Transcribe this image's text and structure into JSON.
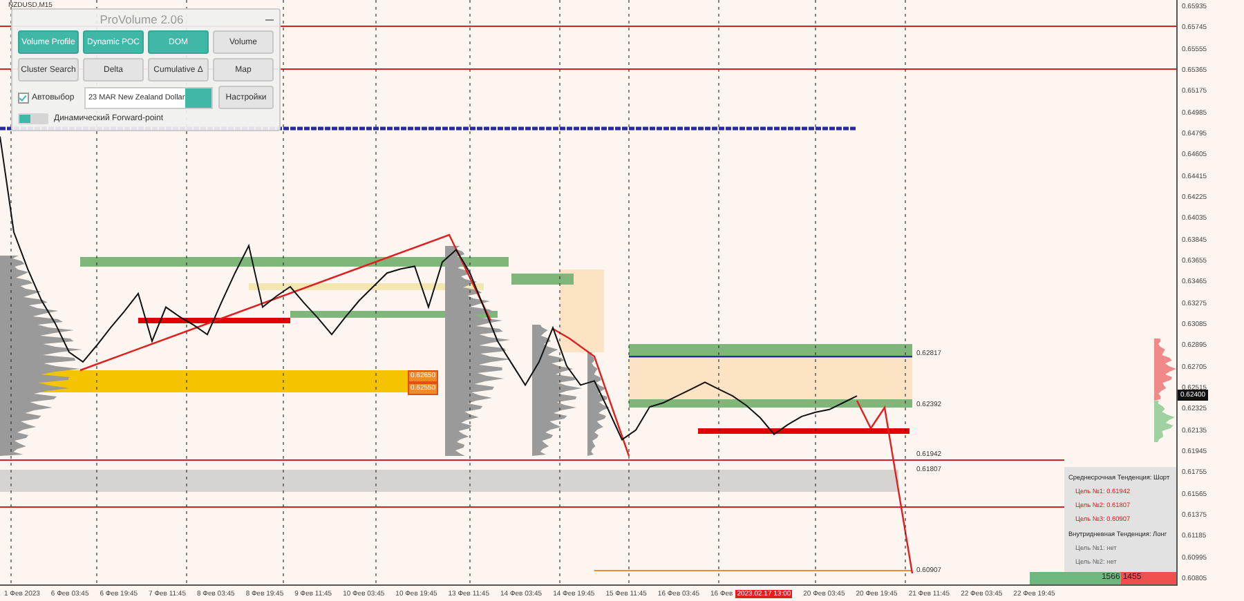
{
  "chart": {
    "chart_data": {
      "type": "line",
      "grid": true,
      "ylim": [
        0.60756,
        0.65996
      ],
      "yticks": [
        {
          "value": 0.65935,
          "label": "0.65935"
        },
        {
          "value": 0.65745,
          "label": "0.65745"
        },
        {
          "value": 0.65555,
          "label": "0.65555"
        },
        {
          "value": 0.65365,
          "label": "0.65365"
        },
        {
          "value": 0.65175,
          "label": "0.65175"
        },
        {
          "value": 0.64985,
          "label": "0.64985"
        },
        {
          "value": 0.64795,
          "label": "0.64795"
        },
        {
          "value": 0.64605,
          "label": "0.64605"
        },
        {
          "value": 0.64415,
          "label": "0.64415"
        },
        {
          "value": 0.64225,
          "label": "0.64225"
        },
        {
          "value": 0.64035,
          "label": "0.64035"
        },
        {
          "value": 0.63845,
          "label": "0.63845"
        },
        {
          "value": 0.63655,
          "label": "0.63655"
        },
        {
          "value": 0.63465,
          "label": "0.63465"
        },
        {
          "value": 0.63275,
          "label": "0.63275"
        },
        {
          "value": 0.63085,
          "label": "0.63085"
        },
        {
          "value": 0.62895,
          "label": "0.62895"
        },
        {
          "value": 0.62705,
          "label": "0.62705"
        },
        {
          "value": 0.62515,
          "label": "0.62515"
        },
        {
          "value": 0.62325,
          "label": "0.62325"
        },
        {
          "value": 0.62135,
          "label": "0.62135"
        },
        {
          "value": 0.61945,
          "label": "0.61945"
        },
        {
          "value": 0.61755,
          "label": "0.61755"
        },
        {
          "value": 0.61565,
          "label": "0.61565"
        },
        {
          "value": 0.61375,
          "label": "0.61375"
        },
        {
          "value": 0.61185,
          "label": "0.61185"
        },
        {
          "value": 0.60995,
          "label": "0.60995"
        },
        {
          "value": 0.60805,
          "label": "0.60805"
        }
      ],
      "series": [
        {
          "name": "NZDUSD,M15",
          "color": "#111111",
          "values": [
            0.64772,
            0.63915,
            0.63585,
            0.63303,
            0.63095,
            0.62838,
            0.62752,
            0.62899,
            0.63058,
            0.63205,
            0.63364,
            0.62936,
            0.63242,
            0.63156,
            0.63083,
            0.62997,
            0.63279,
            0.63548,
            0.63793,
            0.63242,
            0.6334,
            0.63425,
            0.63279,
            0.63144,
            0.62997,
            0.63156,
            0.63303,
            0.63425,
            0.63548,
            0.63585,
            0.63609,
            0.63242,
            0.63646,
            0.63756,
            0.63548,
            0.63242,
            0.62936,
            0.6274,
            0.62544,
            0.62752,
            0.63058,
            0.62715,
            0.62544,
            0.62581,
            0.62324,
            0.62054,
            0.6214,
            0.62348,
            0.62385,
            0.62446,
            0.62507,
            0.62568,
            0.62507,
            0.62446,
            0.6236,
            0.6225,
            0.62103,
            0.62189,
            0.62262,
            0.62299,
            0.62324,
            0.62385,
            0.62446
          ]
        }
      ]
    },
    "current_price": "0.62400",
    "time_axis": [
      {
        "text": "1 Фев 2023",
        "kind": "label"
      },
      {
        "text": "6 Фев 03:45",
        "kind": "label"
      },
      {
        "text": "6 Фев 19:45",
        "kind": "label"
      },
      {
        "text": "7 Фев 11:45",
        "kind": "label"
      },
      {
        "text": "8 Фев 03:45",
        "kind": "label"
      },
      {
        "text": "8 Фев 19:45",
        "kind": "label"
      },
      {
        "text": "9 Фев 11:45",
        "kind": "label"
      },
      {
        "text": "10 Фев 03:45",
        "kind": "label"
      },
      {
        "text": "10 Фев 19:45",
        "kind": "label"
      },
      {
        "text": "13 Фев 11:45",
        "kind": "label"
      },
      {
        "text": "14 Фев 03:45",
        "kind": "label"
      },
      {
        "text": "14 Фев 19:45",
        "kind": "label"
      },
      {
        "text": "15 Фев 11:45",
        "kind": "label"
      },
      {
        "text": "16 Фев 03:45",
        "kind": "label"
      },
      {
        "text": "16 Фев",
        "kind": "label"
      },
      {
        "text": "2023.02.17 13:00",
        "kind": "marker"
      },
      {
        "text": "20 Фев 03:45",
        "kind": "label"
      },
      {
        "text": "20 Фев 19:45",
        "kind": "label"
      },
      {
        "text": "21 Фев 11:45",
        "kind": "label"
      },
      {
        "text": "22 Фев 03:45",
        "kind": "label"
      },
      {
        "text": "22 Фев 19:45",
        "kind": "label"
      }
    ],
    "level_labels": [
      {
        "text": "0.62650",
        "kind": "box"
      },
      {
        "text": "0.62550",
        "kind": "box"
      },
      {
        "text": "0.62817",
        "kind": "plain"
      },
      {
        "text": "0.62392",
        "kind": "plain"
      },
      {
        "text": "0.61942",
        "kind": "plain"
      },
      {
        "text": "0.61807",
        "kind": "plain"
      },
      {
        "text": "0.60907",
        "kind": "plain"
      }
    ]
  },
  "panel": {
    "title": "ProVolume 2.06",
    "buttons": [
      {
        "label": "Volume Profile",
        "selected": true
      },
      {
        "label": "Dynamic POC",
        "selected": true
      },
      {
        "label": "DOM",
        "selected": true
      },
      {
        "label": "Volume",
        "selected": false
      },
      {
        "label": "Cluster Search",
        "selected": false
      },
      {
        "label": "Delta",
        "selected": false
      },
      {
        "label": "Cumulative Δ",
        "selected": false
      },
      {
        "label": "Map",
        "selected": false
      }
    ],
    "auto_select": {
      "label": "Автовыбор",
      "checked": true
    },
    "instrument": {
      "value": "23 MAR New Zealand Dollar"
    },
    "settings_button": "Настройки",
    "forward_point": {
      "label": "Динамический Forward-point",
      "on": false
    }
  },
  "trend_panel": {
    "lines": [
      {
        "text": "Среднесрочная Тенденция: Шорт",
        "kind": "heading"
      },
      {
        "text": "Цель №1: 0.61942",
        "kind": "target"
      },
      {
        "text": "Цель №2: 0.61807",
        "kind": "target"
      },
      {
        "text": "Цель №3: 0.60907",
        "kind": "target"
      },
      {
        "text": "Внутридневная Тенденция: Лонг",
        "kind": "heading"
      },
      {
        "text": "Цель №1: нет",
        "kind": "none"
      },
      {
        "text": "Цель №2: нет",
        "kind": "none"
      }
    ]
  },
  "volume_bar": {
    "buy": "1566",
    "sell": "1455",
    "level": 0.62
  }
}
